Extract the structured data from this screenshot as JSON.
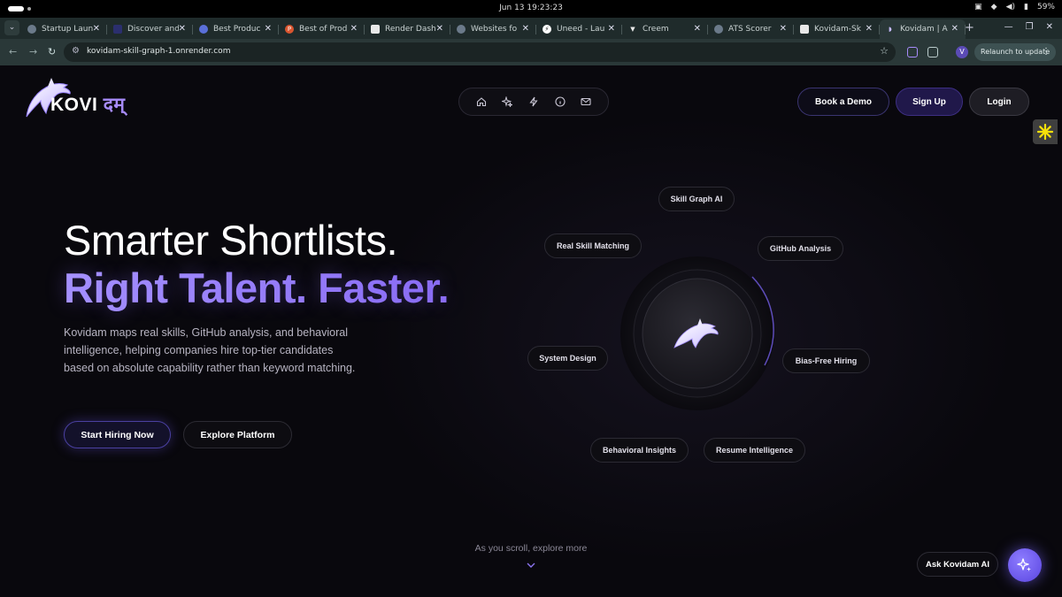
{
  "os": {
    "clock": "Jun 13  19:23:23",
    "battery": "59%"
  },
  "browser": {
    "tabs": [
      {
        "label": "Startup Laun",
        "color": "#6b7a8a"
      },
      {
        "label": "Discover and",
        "color": "#2b2f6e"
      },
      {
        "label": "Best Produc",
        "color": "#5a6fd8"
      },
      {
        "label": "Best of Prod",
        "color": "#da552f"
      },
      {
        "label": "Render Dash",
        "color": "#2c2c2c"
      },
      {
        "label": "Websites fo",
        "color": "#6b7a8a"
      },
      {
        "label": "Uneed - Lau",
        "color": "#ffffff"
      },
      {
        "label": "Creem",
        "color": "#e8e8e8"
      },
      {
        "label": "ATS Scorer",
        "color": "#6b7a8a"
      },
      {
        "label": "Kovidam-Sk",
        "color": "#2c2c2c"
      },
      {
        "label": "Kovidam | A",
        "color": "#a78bfa"
      }
    ],
    "url": "kovidam-skill-graph-1.onrender.com",
    "profile_initial": "V",
    "relaunch_label": "Relaunch to update"
  },
  "brand": {
    "name_latin": "KOVI",
    "name_deva": "दम्"
  },
  "nav": {
    "icons": [
      "home-icon",
      "sparkle-icon",
      "bolt-icon",
      "info-icon",
      "mail-icon"
    ],
    "book_demo": "Book a Demo",
    "sign_up": "Sign Up",
    "login": "Login"
  },
  "hero": {
    "title": "Smarter Shortlists.",
    "subtitle": "Right Talent. Faster.",
    "description": "Kovidam maps real skills, GitHub analysis, and behavioral intelligence, helping companies hire top-tier candidates based on absolute capability rather than keyword matching.",
    "cta_primary": "Start Hiring Now",
    "cta_secondary": "Explore Platform",
    "accent_color": "#9b85ff"
  },
  "orbit": {
    "chips": [
      "Skill Graph AI",
      "Real Skill Matching",
      "GitHub Analysis",
      "System Design",
      "Bias-Free Hiring",
      "Behavioral Insights",
      "Resume Intelligence"
    ]
  },
  "footer": {
    "scroll_hint": "As you scroll, explore more",
    "ask_label": "Ask Kovidam AI"
  }
}
